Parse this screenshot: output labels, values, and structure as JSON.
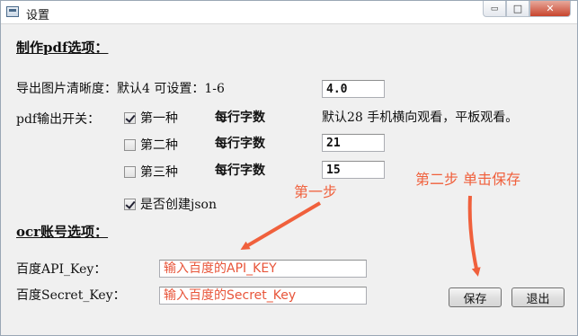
{
  "window": {
    "title": "设置",
    "controls": {
      "minimize": "▭",
      "maximize": "□",
      "close": "✕"
    }
  },
  "pdf_section": {
    "title": "制作pdf选项：",
    "clarity_label": "导出图片清晰度：默认4  可设置：1-6",
    "clarity_value": "4.0",
    "switch_label": "pdf输出开关：",
    "options": [
      {
        "label": "第一种",
        "checked": true,
        "chars_label": "每行字数",
        "note": "默认28  手机横向观看，平板观看。"
      },
      {
        "label": "第二种",
        "checked": false,
        "chars_label": "每行字数",
        "value": "21"
      },
      {
        "label": "第三种",
        "checked": false,
        "chars_label": "每行字数",
        "value": "15"
      }
    ],
    "json_checkbox": {
      "label": "是否创建json",
      "checked": true
    }
  },
  "ocr_section": {
    "title": "ocr账号选项：",
    "api_key_label": "百度API_Key：",
    "api_key_value": "输入百度的API_KEY",
    "secret_key_label": "百度Secret_Key：",
    "secret_key_value": "输入百度的Secret_Key"
  },
  "buttons": {
    "save": "保存",
    "exit": "退出"
  },
  "annotations": {
    "step1": "第一步",
    "step2": "第二步 单击保存",
    "color": "#f0603c"
  }
}
